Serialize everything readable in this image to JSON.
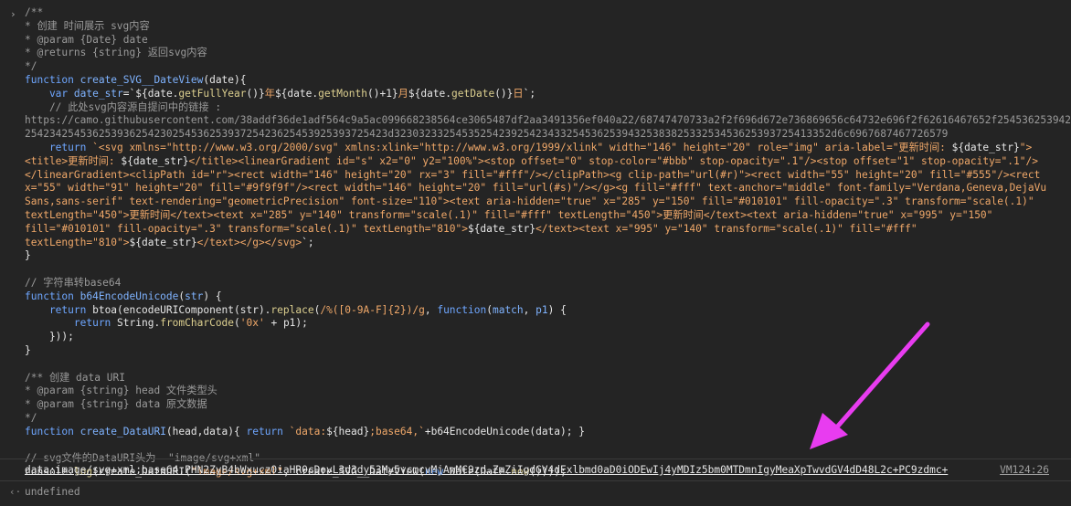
{
  "console": {
    "entry_chevron": "›",
    "return_chevron": "‹·",
    "code_lines": [
      [
        {
          "t": "/**",
          "c": "com"
        }
      ],
      [
        {
          "t": "* 创建 时间展示 svg内容",
          "c": "com"
        }
      ],
      [
        {
          "t": "* @param {Date} date",
          "c": "com"
        }
      ],
      [
        {
          "t": "* @returns {string} 返回svg内容",
          "c": "com"
        }
      ],
      [
        {
          "t": "*/",
          "c": "com"
        }
      ],
      [
        {
          "t": "function ",
          "c": "kw"
        },
        {
          "t": "create_SVG__DateView",
          "c": "fn"
        },
        {
          "t": "(date){",
          "c": "plain"
        }
      ],
      [
        {
          "t": "    var ",
          "c": "kw"
        },
        {
          "t": "date_str",
          "c": "fn"
        },
        {
          "t": "=`",
          "c": "plain"
        },
        {
          "t": "${date.",
          "c": "plain"
        },
        {
          "t": "getFullYear",
          "c": "fncall"
        },
        {
          "t": "()}",
          "c": "plain"
        },
        {
          "t": "年",
          "c": "str"
        },
        {
          "t": "${date.",
          "c": "plain"
        },
        {
          "t": "getMonth",
          "c": "fncall"
        },
        {
          "t": "()+1}",
          "c": "plain"
        },
        {
          "t": "月",
          "c": "str"
        },
        {
          "t": "${date.",
          "c": "plain"
        },
        {
          "t": "getDate",
          "c": "fncall"
        },
        {
          "t": "()}",
          "c": "plain"
        },
        {
          "t": "日",
          "c": "str"
        },
        {
          "t": "`;",
          "c": "plain"
        }
      ],
      [
        {
          "t": "    // 此处svg内容源自提问中的链接 :",
          "c": "com"
        }
      ],
      [
        {
          "t": "https://camo.githubusercontent.com/38addf36de1adf564c9a5ac099668238564ce3065487df2aa3491356ef040a22/68747470733a2f2f696d672e736869656c64732e696f2f62616467652f254536253942",
          "c": "com"
        }
      ],
      [
        {
          "t": "25423425453625393625423025453625393725423625453925393725423d32303233254535254239254234332545362539432538382533253453625393725413352d6c6967687467726579",
          "c": "com"
        }
      ],
      [
        {
          "t": "    return ",
          "c": "kw"
        },
        {
          "t": "`<svg xmlns=\"http://www.w3.org/2000/svg\" xmlns:xlink=\"http://www.w3.org/1999/xlink\" width=\"146\" height=\"20\" role=\"img\" aria-label=\"更新时间: ",
          "c": "str"
        },
        {
          "t": "${date_str}",
          "c": "plain"
        },
        {
          "t": "\">",
          "c": "str"
        }
      ],
      [
        {
          "t": "<title>更新时间: ",
          "c": "str"
        },
        {
          "t": "${date_str}",
          "c": "plain"
        },
        {
          "t": "</title><linearGradient id=\"s\" x2=\"0\" y2=\"100%\"><stop offset=\"0\" stop-color=\"#bbb\" stop-opacity=\".1\"/><stop offset=\"1\" stop-opacity=\".1\"/>",
          "c": "str"
        }
      ],
      [
        {
          "t": "</linearGradient><clipPath id=\"r\"><rect width=\"146\" height=\"20\" rx=\"3\" fill=\"#fff\"/></clipPath><g clip-path=\"url(#r)\"><rect width=\"55\" height=\"20\" fill=\"#555\"/><rect",
          "c": "str"
        }
      ],
      [
        {
          "t": "x=\"55\" width=\"91\" height=\"20\" fill=\"#9f9f9f\"/><rect width=\"146\" height=\"20\" fill=\"url(#s)\"/></g><g fill=\"#fff\" text-anchor=\"middle\" font-family=\"Verdana,Geneva,DejaVu",
          "c": "str"
        }
      ],
      [
        {
          "t": "Sans,sans-serif\" text-rendering=\"geometricPrecision\" font-size=\"110\"><text aria-hidden=\"true\" x=\"285\" y=\"150\" fill=\"#010101\" fill-opacity=\".3\" transform=\"scale(.1)\"",
          "c": "str"
        }
      ],
      [
        {
          "t": "textLength=\"450\">更新时间</text><text x=\"285\" y=\"140\" transform=\"scale(.1)\" fill=\"#fff\" textLength=\"450\">更新时间</text><text aria-hidden=\"true\" x=\"995\" y=\"150\"",
          "c": "str"
        }
      ],
      [
        {
          "t": "fill=\"#010101\" fill-opacity=\".3\" transform=\"scale(.1)\" textLength=\"810\">",
          "c": "str"
        },
        {
          "t": "${date_str}",
          "c": "plain"
        },
        {
          "t": "</text><text x=\"995\" y=\"140\" transform=\"scale(.1)\" fill=\"#fff\"",
          "c": "str"
        }
      ],
      [
        {
          "t": "textLength=\"810\">",
          "c": "str"
        },
        {
          "t": "${date_str}",
          "c": "plain"
        },
        {
          "t": "</text></g></svg>",
          "c": "str"
        },
        {
          "t": "`;",
          "c": "plain"
        }
      ],
      [
        {
          "t": "}",
          "c": "plain"
        }
      ],
      [
        {
          "t": "",
          "c": "plain"
        }
      ],
      [
        {
          "t": "// 字符串转base64",
          "c": "com"
        }
      ],
      [
        {
          "t": "function ",
          "c": "kw"
        },
        {
          "t": "b64EncodeUnicode",
          "c": "fn"
        },
        {
          "t": "(",
          "c": "plain"
        },
        {
          "t": "str",
          "c": "fn"
        },
        {
          "t": ") {",
          "c": "plain"
        }
      ],
      [
        {
          "t": "    return ",
          "c": "kw"
        },
        {
          "t": "btoa(encodeURIComponent(str).",
          "c": "plain"
        },
        {
          "t": "replace",
          "c": "fncall"
        },
        {
          "t": "(",
          "c": "plain"
        },
        {
          "t": "/%([0-9A-F]{2})/g",
          "c": "str"
        },
        {
          "t": ", ",
          "c": "plain"
        },
        {
          "t": "function",
          "c": "kw"
        },
        {
          "t": "(",
          "c": "plain"
        },
        {
          "t": "match",
          "c": "fn"
        },
        {
          "t": ", ",
          "c": "plain"
        },
        {
          "t": "p1",
          "c": "fn"
        },
        {
          "t": ") {",
          "c": "plain"
        }
      ],
      [
        {
          "t": "        return ",
          "c": "kw"
        },
        {
          "t": "String.",
          "c": "plain"
        },
        {
          "t": "fromCharCode",
          "c": "fncall"
        },
        {
          "t": "(",
          "c": "plain"
        },
        {
          "t": "'0x'",
          "c": "str"
        },
        {
          "t": " + p1);",
          "c": "plain"
        }
      ],
      [
        {
          "t": "    }));",
          "c": "plain"
        }
      ],
      [
        {
          "t": "}",
          "c": "plain"
        }
      ],
      [
        {
          "t": "",
          "c": "plain"
        }
      ],
      [
        {
          "t": "/** 创建 data URI",
          "c": "com"
        }
      ],
      [
        {
          "t": "* @param {string} head 文件类型头",
          "c": "com"
        }
      ],
      [
        {
          "t": "* @param {string} data 原文数据",
          "c": "com"
        }
      ],
      [
        {
          "t": "*/",
          "c": "com"
        }
      ],
      [
        {
          "t": "function ",
          "c": "kw"
        },
        {
          "t": "create_DataURI",
          "c": "fn"
        },
        {
          "t": "(head,data){ ",
          "c": "plain"
        },
        {
          "t": "return ",
          "c": "kw"
        },
        {
          "t": "`data:",
          "c": "str"
        },
        {
          "t": "${head}",
          "c": "plain"
        },
        {
          "t": ";base64,`",
          "c": "str"
        },
        {
          "t": "+b64EncodeUnicode(data); }",
          "c": "plain"
        }
      ],
      [
        {
          "t": "",
          "c": "plain"
        }
      ],
      [
        {
          "t": "// svg文件的DataURI头为  \"image/svg+xml\"",
          "c": "com"
        }
      ],
      [
        {
          "t": "console.",
          "c": "plain"
        },
        {
          "t": "log",
          "c": "fncall"
        },
        {
          "t": "(create_DataURI(",
          "c": "plain"
        },
        {
          "t": "\"image/svg+xml\"",
          "c": "str"
        },
        {
          "t": ", create_SVG__DateView(",
          "c": "plain"
        },
        {
          "t": "new ",
          "c": "kw"
        },
        {
          "t": "Date(Date.",
          "c": "plain"
        },
        {
          "t": "now",
          "c": "fncall"
        },
        {
          "t": "())));",
          "c": "plain"
        }
      ]
    ],
    "result": {
      "text": "data:image/svg+xml;base64,PHN2ZyB4bWxucz0iaHR0cDovL3d3dy53My5vcmcvMjAwMC9zd…ZmZiIgdGV4dExlbmd0aD0iODEwIj4yMDIz5bm0MTDmnIgyMeaXpTwvdGV4dD48L2c+PC9zdmc+",
      "source": "VM124:26"
    },
    "return_value": "undefined",
    "annotation_arrow_color": "#e83cf0"
  }
}
